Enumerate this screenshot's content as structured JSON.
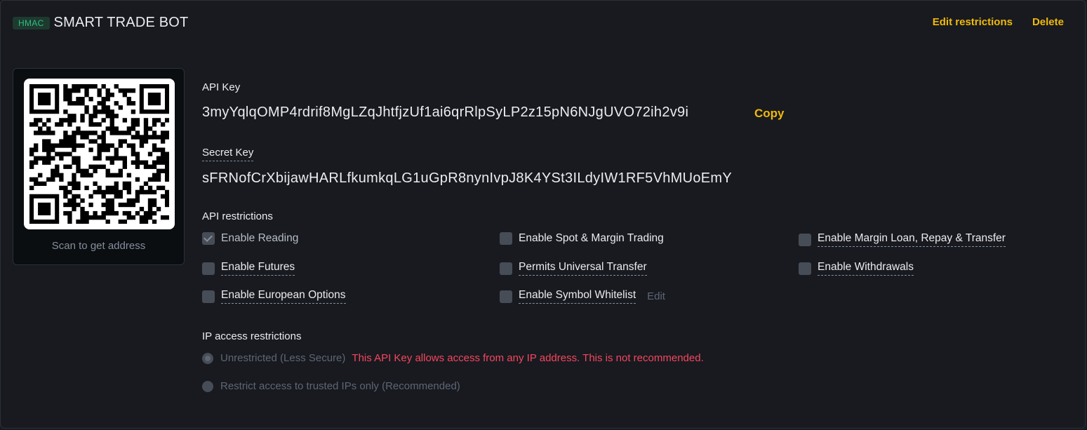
{
  "header": {
    "badge": "HMAC",
    "title": "SMART TRADE BOT",
    "edit_label": "Edit restrictions",
    "delete_label": "Delete"
  },
  "qr": {
    "caption": "Scan to get address",
    "icon": "qr-code-icon"
  },
  "api_key": {
    "label": "API Key",
    "value": "3myYqlqOMP4rdrif8MgLZqJhtfjzUf1ai6qrRlpSyLP2z15pN6NJgUVO72ih2v9i",
    "copy_label": "Copy"
  },
  "secret_key": {
    "label": "Secret Key",
    "value": "sFRNofCrXbijawHARLfkumkqLG1uGpR8nynIvpJ8K4YSt3ILdyIW1RF5VhMUoEmY"
  },
  "restrictions": {
    "label": "API restrictions",
    "items": [
      {
        "label": "Enable Reading",
        "checked": true
      },
      {
        "label": "Enable Spot & Margin Trading",
        "checked": false
      },
      {
        "label": "Enable Margin Loan, Repay & Transfer",
        "checked": false
      },
      {
        "label": "Enable Futures",
        "checked": false
      },
      {
        "label": "Permits Universal Transfer",
        "checked": false
      },
      {
        "label": "Enable Withdrawals",
        "checked": false
      },
      {
        "label": "Enable European Options",
        "checked": false
      },
      {
        "label": "Enable Symbol Whitelist",
        "checked": false
      }
    ],
    "whitelist_edit_label": "Edit"
  },
  "ip_restrictions": {
    "label": "IP access restrictions",
    "options": [
      {
        "label": "Unrestricted (Less Secure)",
        "selected": true
      },
      {
        "label": "Restrict access to trusted IPs only (Recommended)",
        "selected": false
      }
    ],
    "warning": "This API Key allows access from any IP address. This is not recommended."
  },
  "colors": {
    "background": "#181a20",
    "accent": "#f0b90b",
    "danger": "#f6465d",
    "badge_text": "#2ebd85"
  }
}
